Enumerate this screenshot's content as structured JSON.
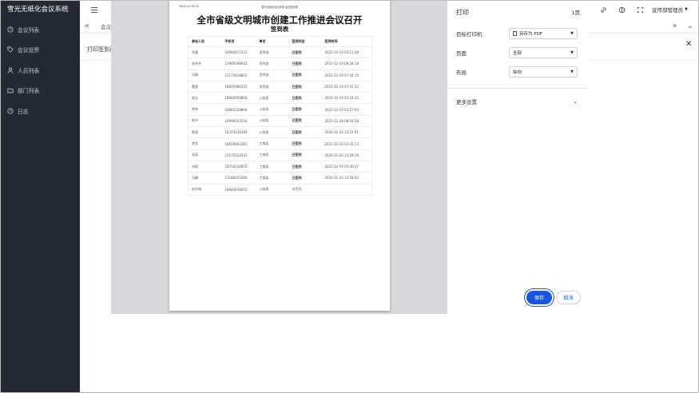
{
  "app": {
    "title": "雪光无纸化会议系统"
  },
  "sidebar": {
    "items": [
      {
        "label": "会议列表",
        "icon": "clock-icon"
      },
      {
        "label": "会议投票",
        "icon": "tag-icon"
      },
      {
        "label": "人员列表",
        "icon": "user-icon"
      },
      {
        "label": "部门列表",
        "icon": "folder-icon"
      },
      {
        "label": "日志",
        "icon": "clock-icon"
      }
    ]
  },
  "tabs": {
    "crumb": "会议"
  },
  "page": {
    "heading": "打印签到表"
  },
  "user": {
    "name": "宣传部管理员"
  },
  "print_preview": {
    "header_date": "2024/1/5 09:18",
    "header_title": "雪光无纸化会议系统-会议签到表",
    "title": "全市省级文明城市创建工作推进会议召开",
    "subtitle": "签到表",
    "columns": [
      "参会人员",
      "手机号",
      "单位",
      "签到状态",
      "签到时间"
    ],
    "rows": [
      [
        "孙晨",
        "18944615523",
        "宣传部",
        "已签到",
        "2023-12-19 03:11:48"
      ],
      [
        "张齐杰",
        "13946598642",
        "宣传部",
        "已签到",
        "2023-12-19 09:28:18"
      ],
      [
        "冯倩",
        "15174618852",
        "宣传部",
        "已签到",
        "2023-12-19 07:44:15"
      ],
      [
        "蒙超",
        "18645986322",
        "宣传部",
        "已签到",
        "2023-12-19 07:41:12"
      ],
      [
        "俞洁",
        "18944659856",
        "公安局",
        "已签到",
        "2023-12-19 03:16:15"
      ],
      [
        "李伟",
        "18965329866",
        "公安局",
        "已签到",
        "2023-12-19 03:27:04"
      ],
      [
        "杨书",
        "16996543256",
        "公安局",
        "已签到",
        "2023-12-28 08:54:58"
      ],
      [
        "陈斌",
        "18725436384",
        "公安局",
        "已签到",
        "2024-01-02 13:57:41"
      ],
      [
        "李军",
        "18656962365",
        "工商局",
        "已签到",
        "2023-12-19 03:32:13"
      ],
      [
        "张英",
        "15175632541",
        "工商局",
        "已签到",
        "2024-01-02 13:58:16"
      ],
      [
        "刘昭",
        "18756230855",
        "工商局",
        "已签到",
        "2023-12-19 05:40:37"
      ],
      [
        "冯峰",
        "15186435286",
        "工商局",
        "已签到",
        "2024-01-02 13:58:42"
      ],
      [
        "赵东城",
        "18944656655",
        "公安局",
        "未签到",
        ""
      ]
    ]
  },
  "print_panel": {
    "title": "打印",
    "pages": "1页",
    "destination_label": "目标打印机",
    "destination_value": "另存为 PDF",
    "pages_label": "页面",
    "pages_value": "全部",
    "layout_label": "布局",
    "layout_value": "纵向",
    "more_settings": "更多设置",
    "save_label": "保存",
    "cancel_label": "取消"
  },
  "colors": {
    "sidebar_bg": "#232a36",
    "accent": "#1a56db",
    "overlay_bg": "#d6d8dc"
  }
}
